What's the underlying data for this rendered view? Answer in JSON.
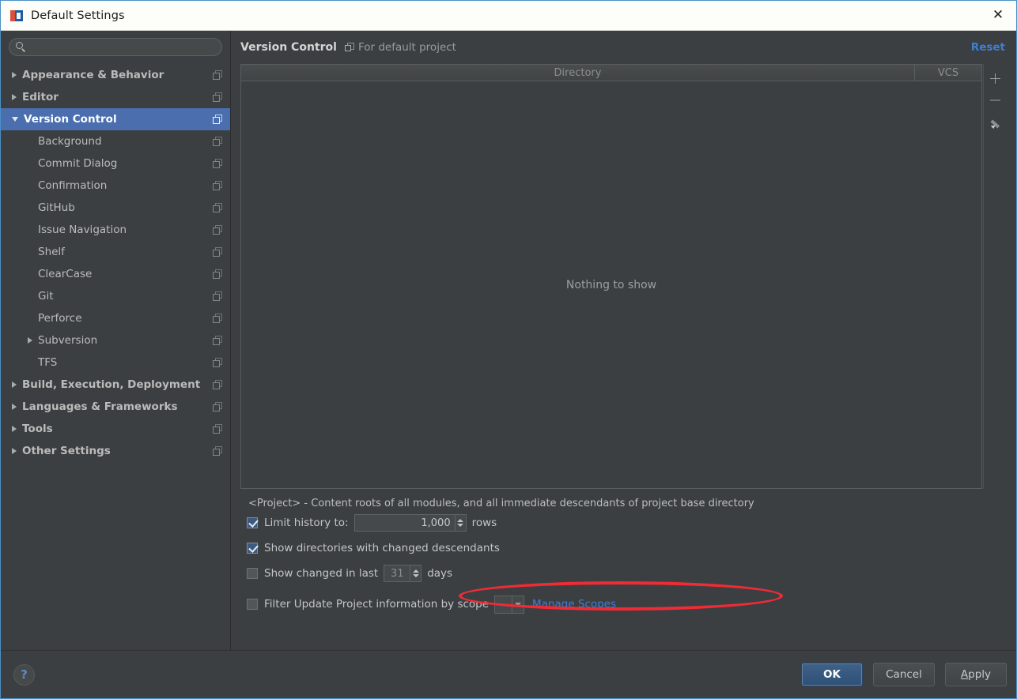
{
  "window": {
    "title": "Default Settings",
    "close_label": "✕",
    "app_icon": "intellij-icon"
  },
  "sidebar": {
    "search": {
      "value": "",
      "placeholder": ""
    },
    "items": [
      {
        "label": "Appearance & Behavior",
        "level": 0,
        "arrow": "right",
        "bold": true,
        "selected": false,
        "copy_icon": true
      },
      {
        "label": "Editor",
        "level": 0,
        "arrow": "right",
        "bold": true,
        "selected": false,
        "copy_icon": true
      },
      {
        "label": "Version Control",
        "level": 0,
        "arrow": "down",
        "bold": true,
        "selected": true,
        "copy_icon": true
      },
      {
        "label": "Background",
        "level": 1,
        "arrow": "none",
        "bold": false,
        "selected": false,
        "copy_icon": true
      },
      {
        "label": "Commit Dialog",
        "level": 1,
        "arrow": "none",
        "bold": false,
        "selected": false,
        "copy_icon": true
      },
      {
        "label": "Confirmation",
        "level": 1,
        "arrow": "none",
        "bold": false,
        "selected": false,
        "copy_icon": true
      },
      {
        "label": "GitHub",
        "level": 1,
        "arrow": "none",
        "bold": false,
        "selected": false,
        "copy_icon": true
      },
      {
        "label": "Issue Navigation",
        "level": 1,
        "arrow": "none",
        "bold": false,
        "selected": false,
        "copy_icon": true
      },
      {
        "label": "Shelf",
        "level": 1,
        "arrow": "none",
        "bold": false,
        "selected": false,
        "copy_icon": true
      },
      {
        "label": "ClearCase",
        "level": 1,
        "arrow": "none",
        "bold": false,
        "selected": false,
        "copy_icon": true
      },
      {
        "label": "Git",
        "level": 1,
        "arrow": "none",
        "bold": false,
        "selected": false,
        "copy_icon": true
      },
      {
        "label": "Perforce",
        "level": 1,
        "arrow": "none",
        "bold": false,
        "selected": false,
        "copy_icon": true
      },
      {
        "label": "Subversion",
        "level": 1,
        "arrow": "right",
        "bold": false,
        "selected": false,
        "copy_icon": true
      },
      {
        "label": "TFS",
        "level": 1,
        "arrow": "none",
        "bold": false,
        "selected": false,
        "copy_icon": true
      },
      {
        "label": "Build, Execution, Deployment",
        "level": 0,
        "arrow": "right",
        "bold": true,
        "selected": false,
        "copy_icon": true
      },
      {
        "label": "Languages & Frameworks",
        "level": 0,
        "arrow": "right",
        "bold": true,
        "selected": false,
        "copy_icon": true
      },
      {
        "label": "Tools",
        "level": 0,
        "arrow": "right",
        "bold": true,
        "selected": false,
        "copy_icon": true
      },
      {
        "label": "Other Settings",
        "level": 0,
        "arrow": "right",
        "bold": true,
        "selected": false,
        "copy_icon": true
      }
    ]
  },
  "main": {
    "title": "Version Control",
    "subtitle": "For default project",
    "reset_label": "Reset",
    "table": {
      "columns": [
        "Directory",
        "VCS"
      ],
      "empty_text": "Nothing to show",
      "rows": []
    },
    "toolbar": {
      "add_label": "+",
      "remove_label": "–",
      "edit_label": "edit"
    },
    "project_note": "<Project> - Content roots of all modules, and all immediate descendants of project base directory",
    "options": {
      "limit_history": {
        "label": "Limit history to:",
        "checked": true,
        "value": "1,000",
        "unit": "rows"
      },
      "show_directories": {
        "label": "Show directories with changed descendants",
        "checked": true,
        "highlighted": true
      },
      "show_changed_last": {
        "label": "Show changed in last",
        "checked": false,
        "value": "31",
        "unit": "days"
      },
      "filter_update": {
        "label": "Filter Update Project information by scope",
        "checked": false,
        "scope_value": "",
        "manage_link": "Manage Scopes"
      }
    }
  },
  "footer": {
    "help_label": "?",
    "buttons": [
      {
        "label": "OK",
        "primary": true
      },
      {
        "label": "Cancel",
        "primary": false
      },
      {
        "label": "Apply",
        "primary": false,
        "mnemonic": "A"
      }
    ]
  },
  "colors": {
    "background": "#3c3f41",
    "selection": "#4b6eaf",
    "link": "#3d7fd6",
    "annotation": "#f02b36",
    "title_bar": "#fdfdfa"
  }
}
